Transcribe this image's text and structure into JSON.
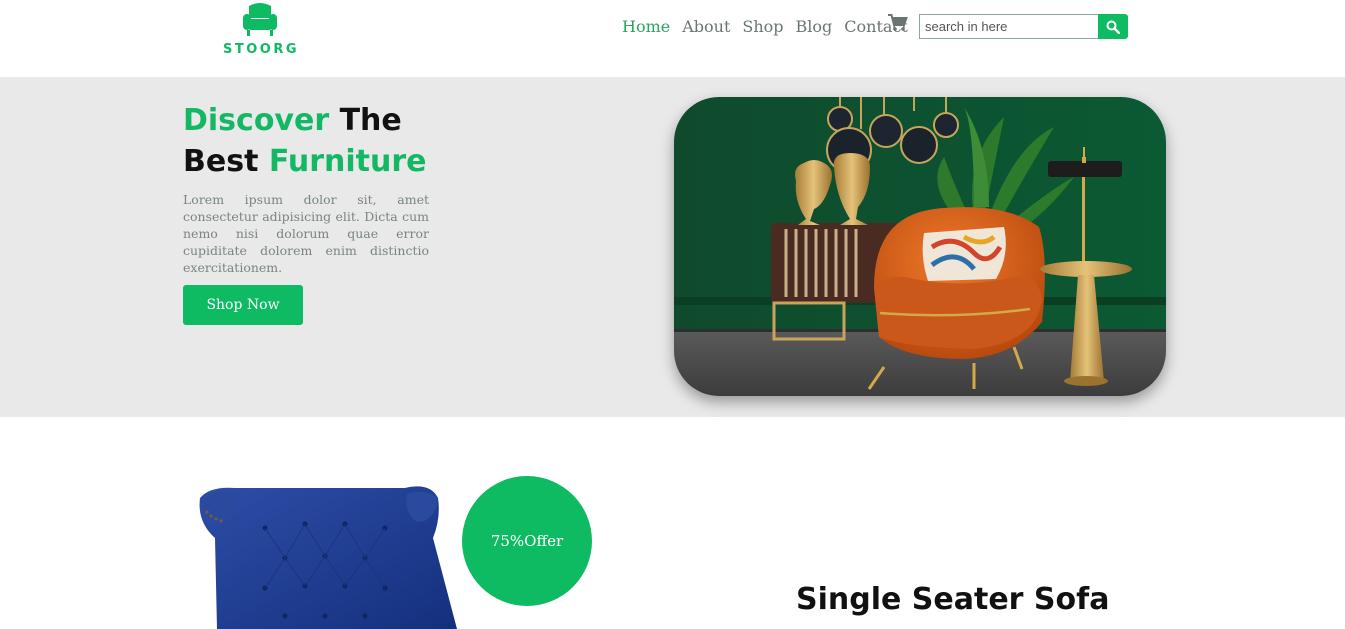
{
  "brand": {
    "name": "STOORG",
    "color": "#0fbb62"
  },
  "nav": {
    "items": [
      {
        "label": "Home",
        "active": true
      },
      {
        "label": "About",
        "active": false
      },
      {
        "label": "Shop",
        "active": false
      },
      {
        "label": "Blog",
        "active": false
      },
      {
        "label": "Contact",
        "active": false
      }
    ],
    "cart_icon": "cart-icon"
  },
  "search": {
    "placeholder": "search in here",
    "value": "",
    "button_icon": "search-icon"
  },
  "hero": {
    "title_word1": "Discover",
    "title_word2": "The",
    "title_word3": "Best",
    "title_word4": "Furniture",
    "description": "Lorem ipsum dolor sit, amet consectetur adipisicing elit. Dicta cum nemo nisi dolorum quae error cupiditate dolorem enim distinctio exercitationem.",
    "cta_label": "Shop Now"
  },
  "product": {
    "offer_label": "75%Offer",
    "title": "Single Seater Sofa"
  },
  "colors": {
    "accent": "#0fbb62",
    "hero_bg": "#e8e9e8",
    "nav_text": "#6b756f"
  }
}
